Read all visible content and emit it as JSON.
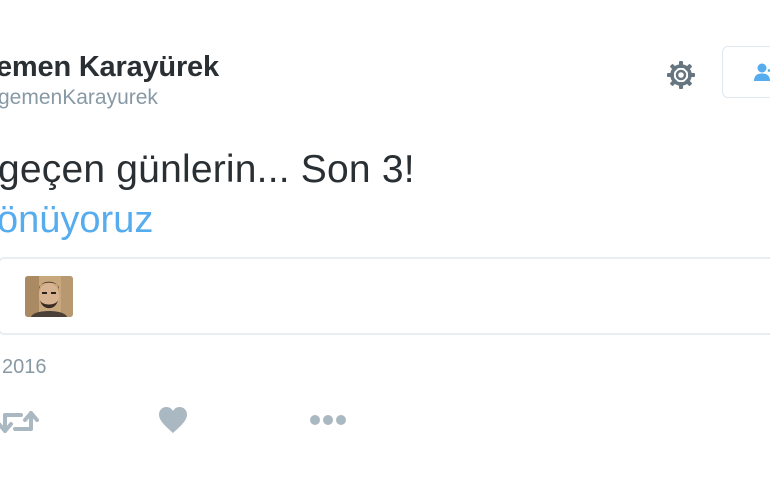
{
  "tweet": {
    "author": {
      "display_name": "emen Karayürek",
      "handle": "gemenKarayurek"
    },
    "text": "geçen günlerin... Son 3!",
    "hashtag": "önüyoruz",
    "date": "2016"
  },
  "header": {
    "settings_icon": "gear-icon",
    "follow_icon": "follow-user-icon"
  },
  "actions": {
    "retweet_icon": "retweet-icon",
    "like_icon": "heart-icon",
    "more_icon": "more-dots-icon"
  },
  "colors": {
    "link": "#55acee",
    "muted": "#8899a6",
    "text": "#292f33",
    "border": "#e1e8ed"
  }
}
